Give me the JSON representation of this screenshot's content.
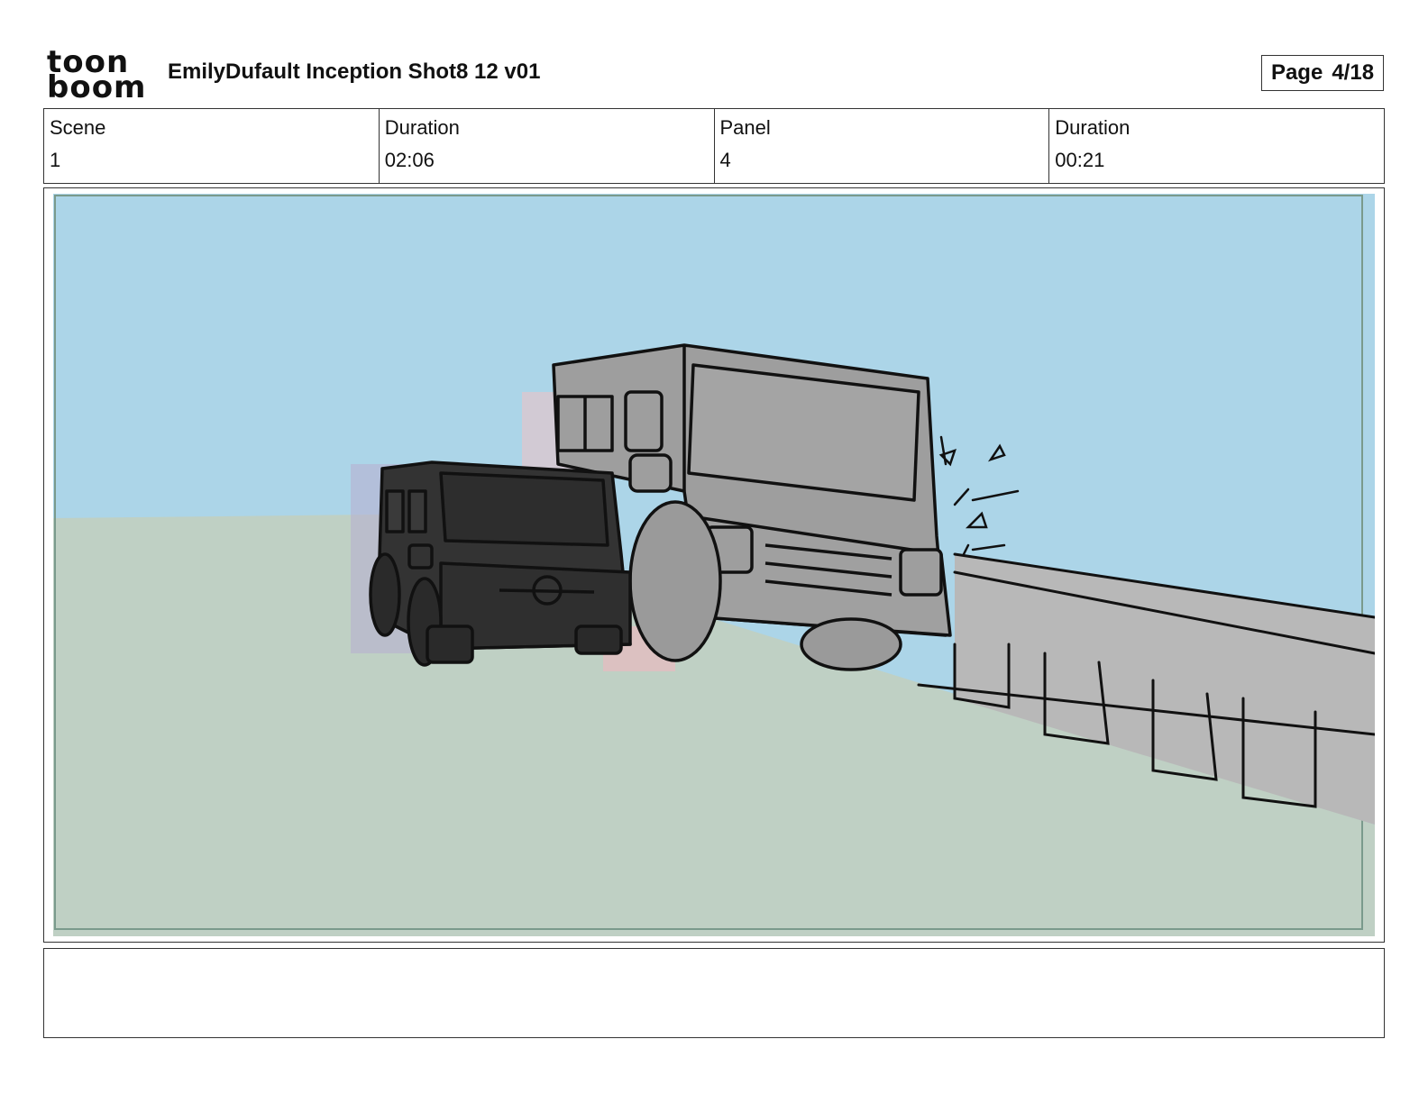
{
  "header": {
    "logo": {
      "line1": "toon",
      "line2": "boom"
    },
    "title": "EmilyDufault Inception Shot8 12 v01",
    "page": {
      "label": "Page",
      "value": "4/18"
    }
  },
  "info": [
    {
      "label": "Scene",
      "value": "1"
    },
    {
      "label": "Duration",
      "value": "02:06"
    },
    {
      "label": "Panel",
      "value": "4"
    },
    {
      "label": "Duration",
      "value": "00:21"
    }
  ],
  "panel": {
    "colors": {
      "sky": "#acd5e8",
      "ground": "#bfd0c4",
      "truck": "#9e9e9e",
      "suv": "#333333",
      "barrier": "#b8b8b8"
    }
  },
  "notes": ""
}
